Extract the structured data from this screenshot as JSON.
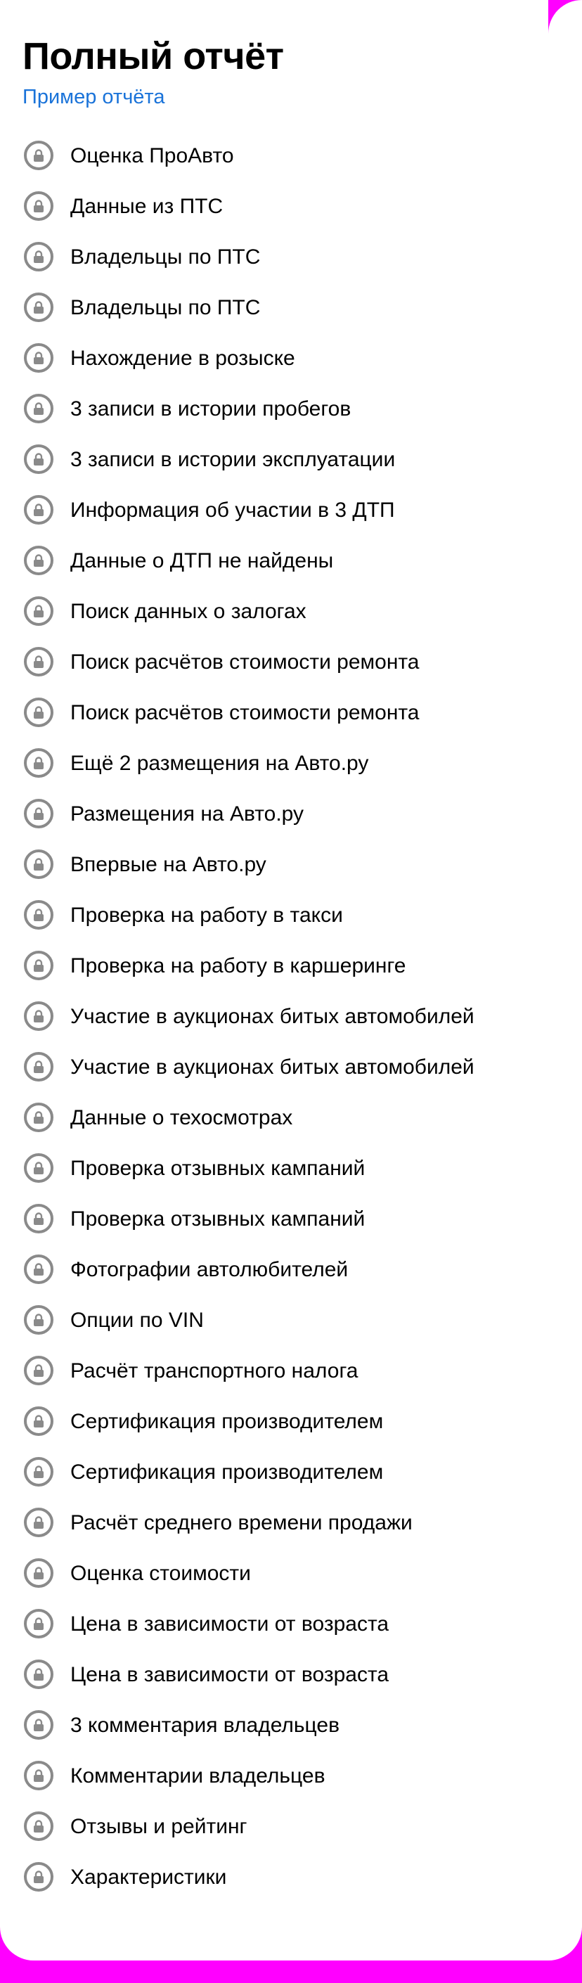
{
  "report": {
    "title": "Полный отчёт",
    "sample_link": "Пример отчёта"
  },
  "items": [
    {
      "label": "Оценка ПроАвто",
      "icon": "lock-icon"
    },
    {
      "label": "Данные из ПТС",
      "icon": "lock-icon"
    },
    {
      "label": "Владельцы по ПТС",
      "icon": "lock-icon"
    },
    {
      "label": "Владельцы по ПТС",
      "icon": "lock-icon"
    },
    {
      "label": "Нахождение в розыске",
      "icon": "lock-icon"
    },
    {
      "label": "3 записи в истории пробегов",
      "icon": "lock-icon"
    },
    {
      "label": "3 записи в истории эксплуатации",
      "icon": "lock-icon"
    },
    {
      "label": "Информация об участии в 3 ДТП",
      "icon": "lock-icon"
    },
    {
      "label": "Данные о ДТП не найдены",
      "icon": "lock-icon"
    },
    {
      "label": "Поиск данных о залогах",
      "icon": "lock-icon"
    },
    {
      "label": "Поиск расчётов стоимости ремонта",
      "icon": "lock-icon"
    },
    {
      "label": "Поиск расчётов стоимости ремонта",
      "icon": "lock-icon"
    },
    {
      "label": "Ещё 2 размещения на Авто.ру",
      "icon": "lock-icon"
    },
    {
      "label": "Размещения на Авто.ру",
      "icon": "lock-icon"
    },
    {
      "label": "Впервые на Авто.ру",
      "icon": "lock-icon"
    },
    {
      "label": "Проверка на работу в такси",
      "icon": "lock-icon"
    },
    {
      "label": "Проверка на работу в каршеринге",
      "icon": "lock-icon"
    },
    {
      "label": "Участие в аукционах битых автомобилей",
      "icon": "lock-icon"
    },
    {
      "label": "Участие в аукционах битых автомобилей",
      "icon": "lock-icon"
    },
    {
      "label": "Данные о техосмотрах",
      "icon": "lock-icon"
    },
    {
      "label": "Проверка отзывных кампаний",
      "icon": "lock-icon"
    },
    {
      "label": "Проверка отзывных кампаний",
      "icon": "lock-icon"
    },
    {
      "label": "Фотографии автолюбителей",
      "icon": "lock-icon"
    },
    {
      "label": "Опции по VIN",
      "icon": "lock-icon"
    },
    {
      "label": "Расчёт транспортного налога",
      "icon": "lock-icon"
    },
    {
      "label": "Сертификация производителем",
      "icon": "lock-icon"
    },
    {
      "label": "Сертификация производителем",
      "icon": "lock-icon"
    },
    {
      "label": "Расчёт среднего времени продажи",
      "icon": "lock-icon"
    },
    {
      "label": "Оценка стоимости",
      "icon": "lock-icon"
    },
    {
      "label": "Цена в зависимости от возраста",
      "icon": "lock-icon"
    },
    {
      "label": "Цена в зависимости от возраста",
      "icon": "lock-icon"
    },
    {
      "label": "3 комментария владельцев",
      "icon": "lock-icon"
    },
    {
      "label": "Комментарии владельцев",
      "icon": "lock-icon"
    },
    {
      "label": "Отзывы и рейтинг",
      "icon": "lock-icon"
    },
    {
      "label": "Характеристики",
      "icon": "lock-icon"
    }
  ],
  "colors": {
    "background": "#ff00ff",
    "card": "#ffffff",
    "link": "#1a73d9",
    "icon": "#8a8a8a"
  }
}
